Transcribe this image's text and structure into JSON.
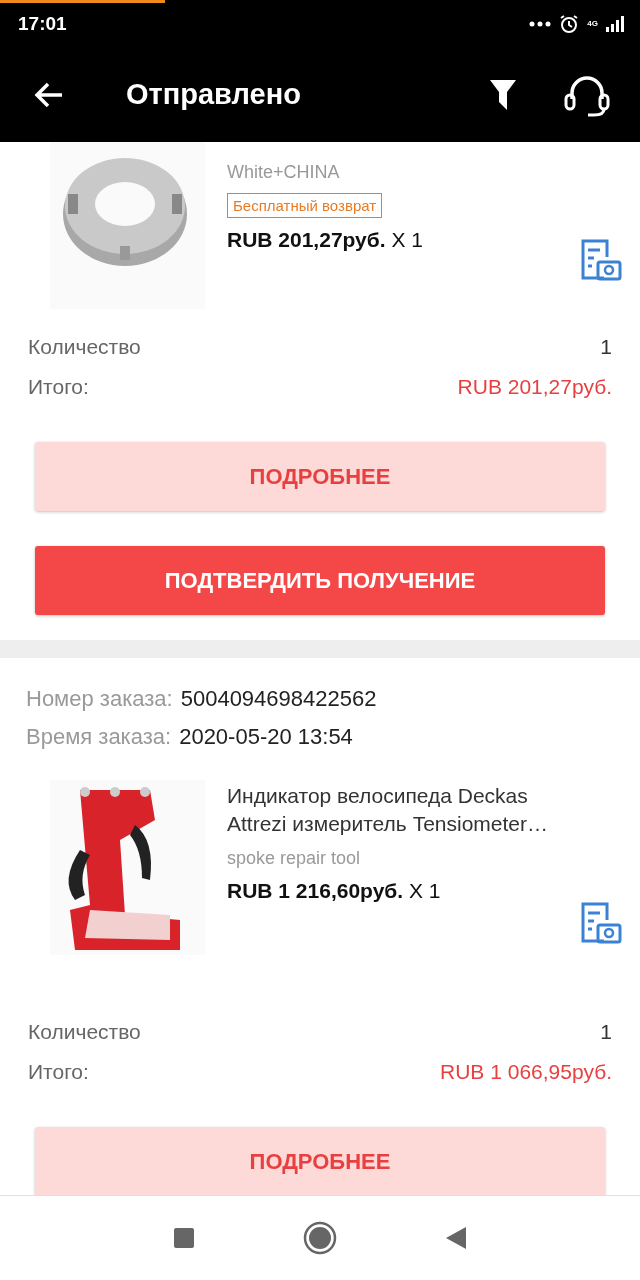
{
  "status_bar": {
    "time": "17:01",
    "network": "4G"
  },
  "header": {
    "title": "Отправлено"
  },
  "orders": [
    {
      "items": [
        {
          "variant": "White+CHINA",
          "badge": "Бесплатный возврат",
          "price": "**RUB 201,27руб.** X 1"
        }
      ],
      "quantity_label": "Количество",
      "quantity": "1",
      "total_label": "Итого:",
      "total": "RUB 201,27руб.",
      "buttons": [
        {
          "label": "ПОДРОБНЕЕ",
          "kind": "secondary"
        },
        {
          "label": "ПОДТВЕРДИТЬ ПОЛУЧЕНИЕ",
          "kind": "primary"
        }
      ]
    },
    {
      "order_number_label": "Номер заказа:",
      "order_number": "5004094698422562",
      "order_time_label": "Время заказа:",
      "order_time": "2020-05-20 13:54",
      "items": [
        {
          "title": "Индикатор велосипеда Deckas Attrezi измеритель Tensiometer…",
          "variant": "spoke repair tool",
          "price": "**RUB 1 216,60руб.** X 1"
        }
      ],
      "quantity_label": "Количество",
      "quantity": "1",
      "total_label": "Итого:",
      "total": "RUB 1 066,95руб.",
      "buttons": [
        {
          "label": "ПОДРОБНЕЕ",
          "kind": "secondary"
        }
      ]
    }
  ]
}
